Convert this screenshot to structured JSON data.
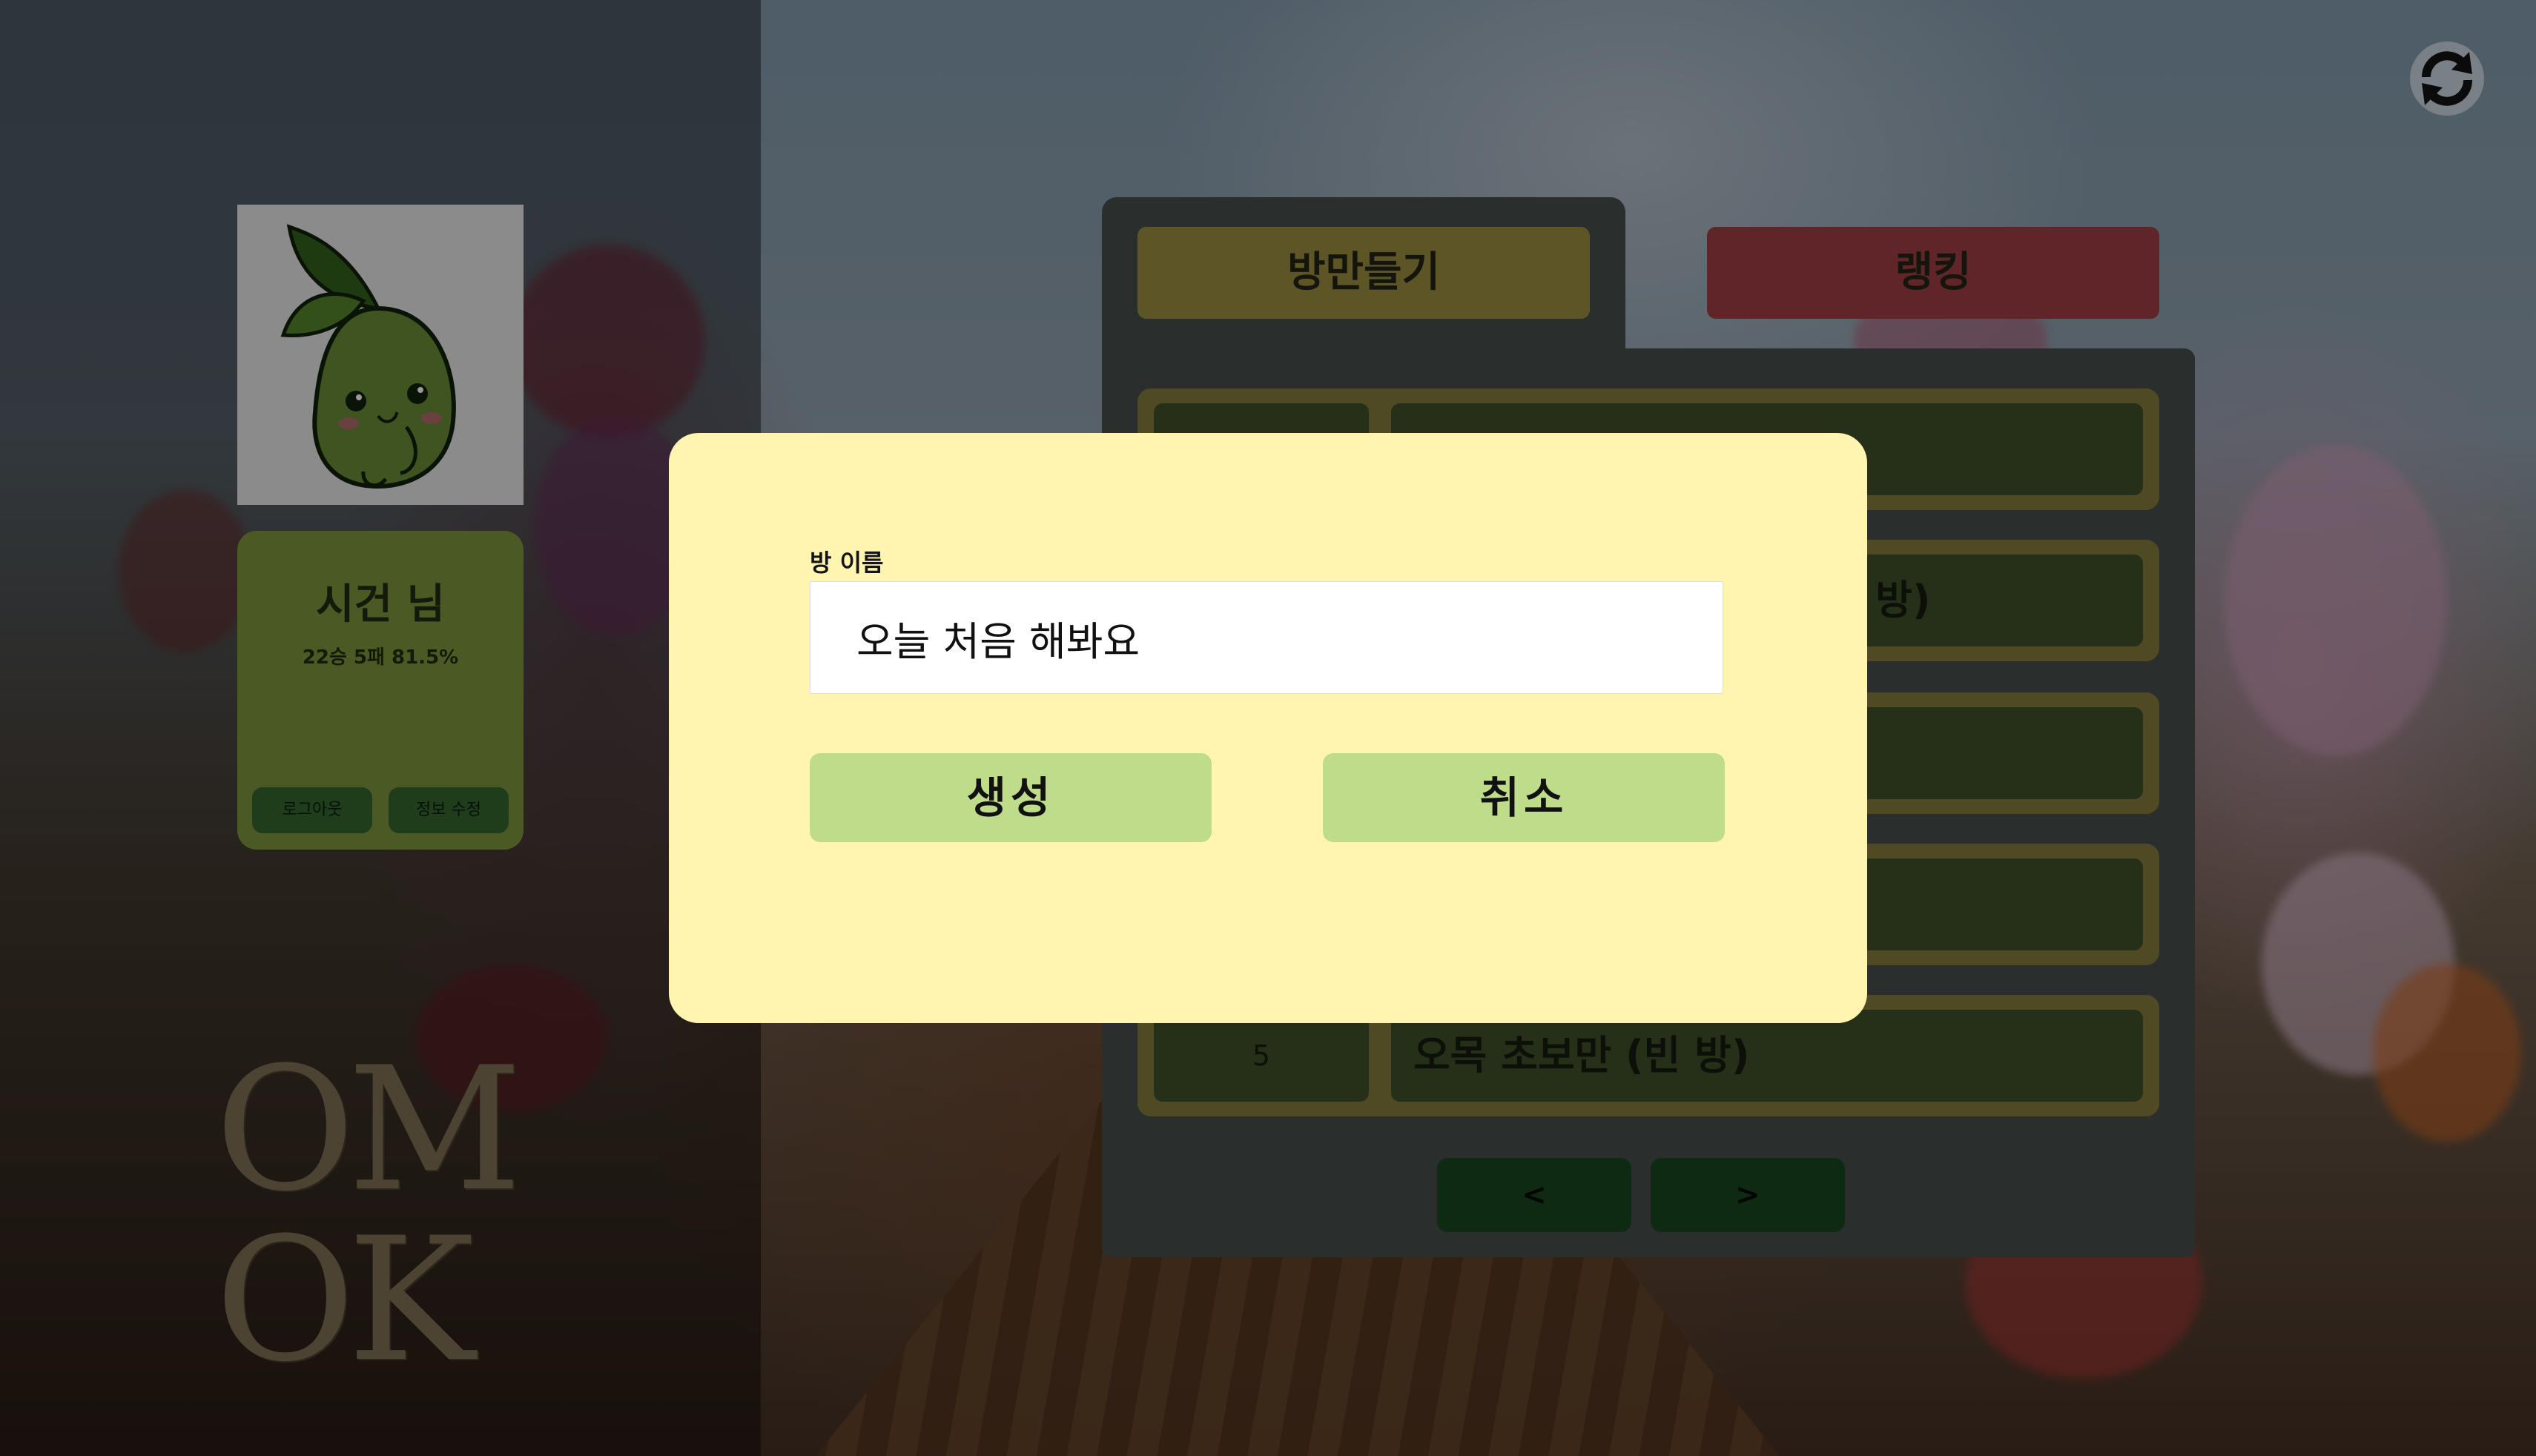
{
  "profile": {
    "name": "시건 님",
    "record": "22승 5패 81.5%",
    "logout_label": "로그아웃",
    "edit_label": "정보 수정"
  },
  "logo": {
    "line1": "OM",
    "line2": "OK"
  },
  "tabs": {
    "create_label": "방만들기",
    "ranking_label": "랭킹"
  },
  "rooms": [
    {
      "number": "",
      "title": ""
    },
    {
      "number": "",
      "title": "(빈 방)"
    },
    {
      "number": "",
      "title": ""
    },
    {
      "number": "",
      "title": ""
    },
    {
      "number": "5",
      "title": "오목 초보만 (빈 방)"
    }
  ],
  "pagination": {
    "prev_label": "<",
    "next_label": ">"
  },
  "modal": {
    "field_label": "방 이름",
    "input_value": "오늘 처음 해봐요",
    "create_label": "생성",
    "cancel_label": "취소"
  },
  "colors": {
    "modal_bg": "#fff5b1",
    "modal_button": "#bfdc8a",
    "tab_create": "#5e5526",
    "tab_ranking": "#602528"
  },
  "icons": {
    "refresh": "refresh-icon",
    "avatar": "sprout-character"
  }
}
